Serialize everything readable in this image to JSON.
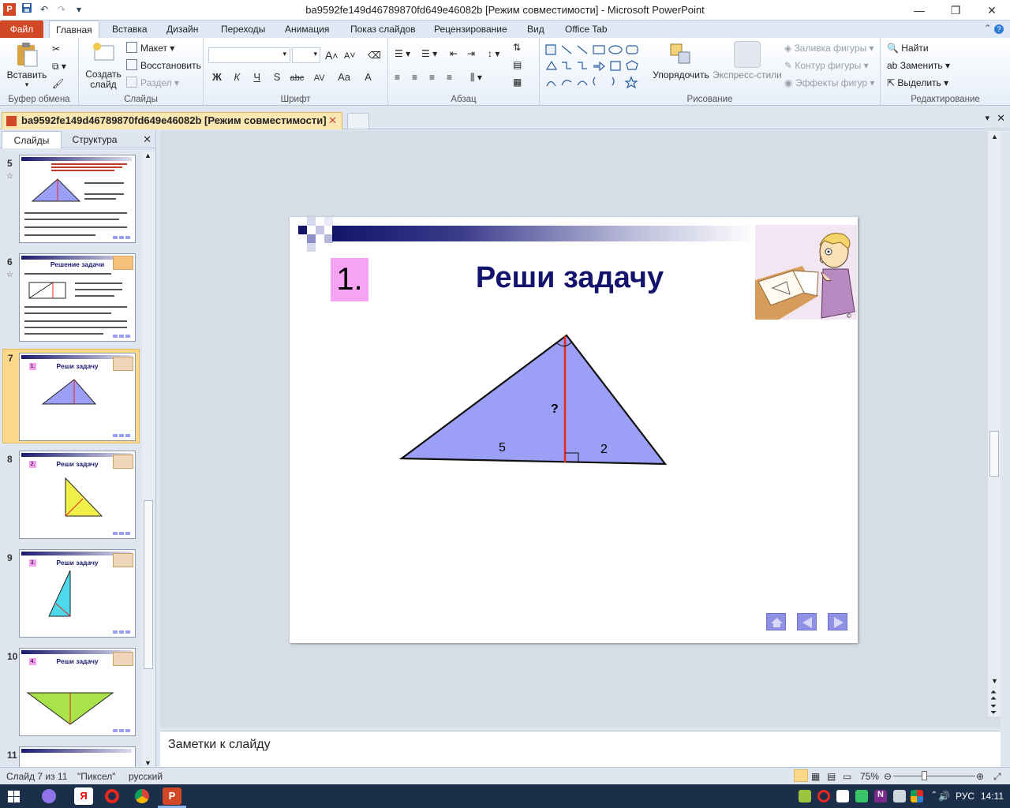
{
  "window": {
    "title": "ba9592fe149d46789870fd649e46082b [Режим совместимости] - Microsoft PowerPoint",
    "app_icon_letter": "P",
    "minimize": "—",
    "restore": "❐",
    "close": "✕"
  },
  "ribbon_tabs": [
    "Файл",
    "Главная",
    "Вставка",
    "Дизайн",
    "Переходы",
    "Анимация",
    "Показ слайдов",
    "Рецензирование",
    "Вид",
    "Office Tab"
  ],
  "ribbon": {
    "clipboard": {
      "label": "Буфер обмена",
      "paste": "Вставить"
    },
    "slides": {
      "label": "Слайды",
      "new_slide": "Создать слайд",
      "layout": "Макет",
      "reset": "Восстановить",
      "section": "Раздел"
    },
    "font": {
      "label": "Шрифт",
      "bold": "Ж",
      "italic": "К",
      "underline": "Ч",
      "shadow": "S",
      "strike": "abc",
      "spacing": "AV",
      "case": "Aa",
      "color": "A",
      "grow": "A",
      "shrink": "A"
    },
    "paragraph": {
      "label": "Абзац"
    },
    "drawing": {
      "label": "Рисование",
      "arrange": "Упорядочить",
      "quick_styles": "Экспресс-стили",
      "fill": "Заливка фигуры",
      "outline": "Контур фигуры",
      "effects": "Эффекты фигур"
    },
    "editing": {
      "label": "Редактирование",
      "find": "Найти",
      "replace": "Заменить",
      "select": "Выделить"
    }
  },
  "doc_tab": {
    "title": "ba9592fe149d46789870fd649e46082b [Режим совместимости]",
    "close": "✕"
  },
  "panel": {
    "tabs": [
      "Слайды",
      "Структура"
    ],
    "close": "✕",
    "thumbnails": [
      {
        "num": "5",
        "title": "",
        "star": "☆"
      },
      {
        "num": "6",
        "title": "Решение задачи",
        "star": "☆"
      },
      {
        "num": "7",
        "title": "Реши задачу",
        "badge": "1."
      },
      {
        "num": "8",
        "title": "Реши задачу",
        "badge": "2."
      },
      {
        "num": "9",
        "title": "Реши задачу",
        "badge": "3."
      },
      {
        "num": "10",
        "title": "Реши задачу",
        "badge": "4."
      },
      {
        "num": "11",
        "title": ""
      }
    ]
  },
  "slide": {
    "number_badge": "1.",
    "title": "Реши задачу",
    "label_question": "?",
    "label_left": "5",
    "label_right": "2",
    "colors": {
      "triangle_fill": "#9b9ff5",
      "height_line": "#e8281e",
      "title": "#14146e",
      "badge": "#f7a3f3"
    }
  },
  "notes": {
    "placeholder": "Заметки к слайду"
  },
  "status": {
    "slide_info": "Слайд 7 из 11",
    "theme": "\"Пиксел\"",
    "language": "русский",
    "zoom": "75%"
  },
  "taskbar": {
    "lang": "РУС",
    "time": "14:11"
  }
}
